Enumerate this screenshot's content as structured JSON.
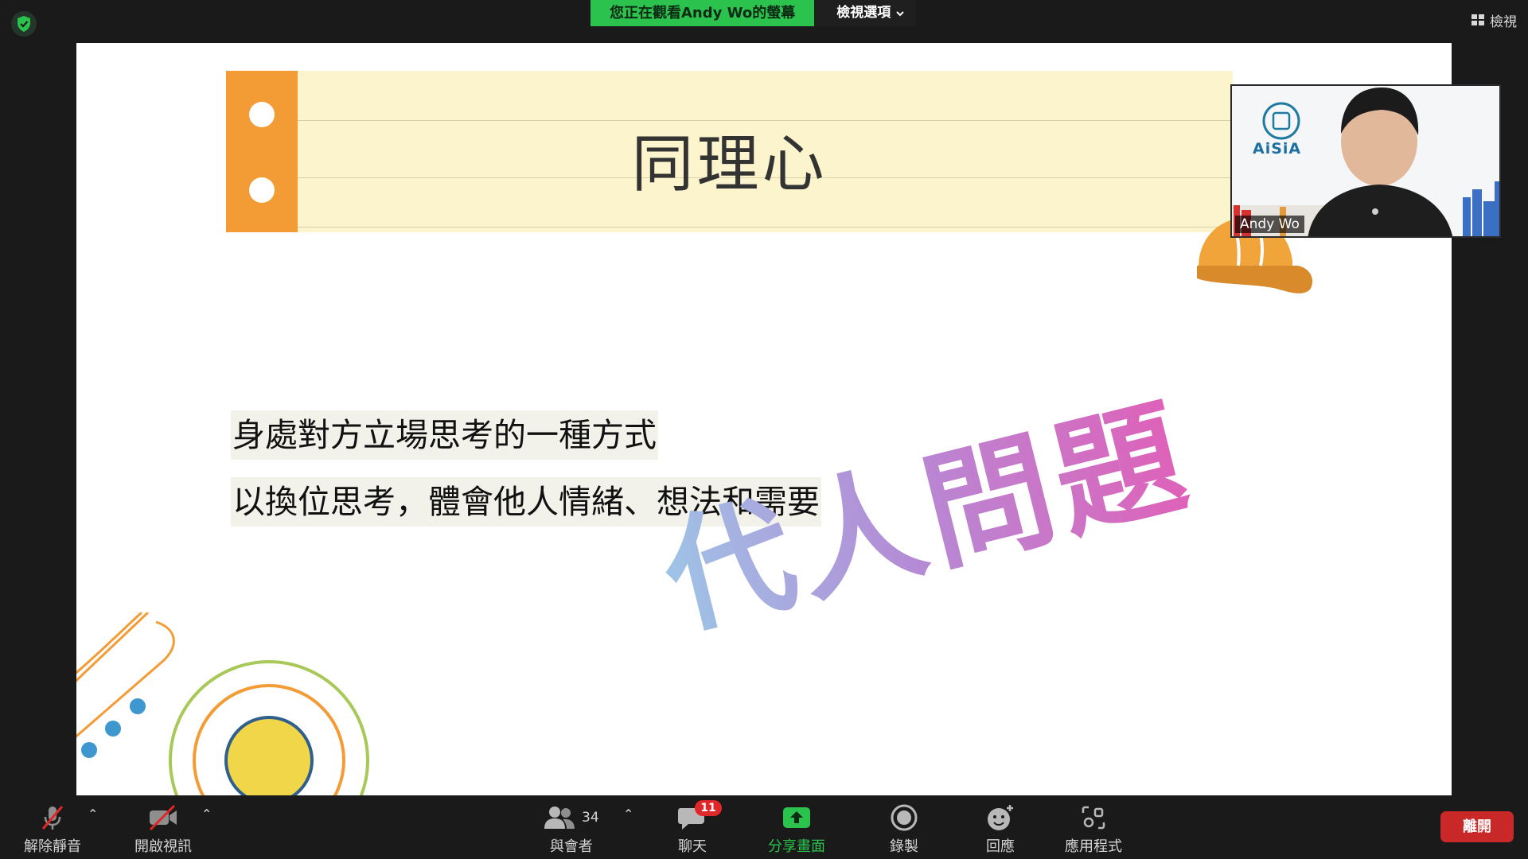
{
  "topbar": {
    "sharing_text": "您正在觀看Andy Wo的螢幕",
    "view_options_label": "檢視選項",
    "view_label": "檢視"
  },
  "slide": {
    "title": "同理心",
    "lines": [
      "身處對方立場思考的一種方式",
      "以換位思考，體會他人情緒、想法和需要"
    ],
    "watermark": "代人問題"
  },
  "video": {
    "participant_name": "Andy Wo",
    "logo_text": "AiSiA"
  },
  "toolbar": {
    "unmute_label": "解除靜音",
    "start_video_label": "開啟視訊",
    "participants_label": "與會者",
    "participants_count": "34",
    "chat_label": "聊天",
    "chat_badge": "11",
    "share_label": "分享畫面",
    "record_label": "錄製",
    "reactions_label": "回應",
    "apps_label": "應用程式",
    "leave_label": "離開"
  },
  "colors": {
    "share_green": "#2bc24e",
    "leave_red": "#c92828",
    "banner_orange": "#f39c36",
    "banner_yellow": "#fbf4cc"
  }
}
